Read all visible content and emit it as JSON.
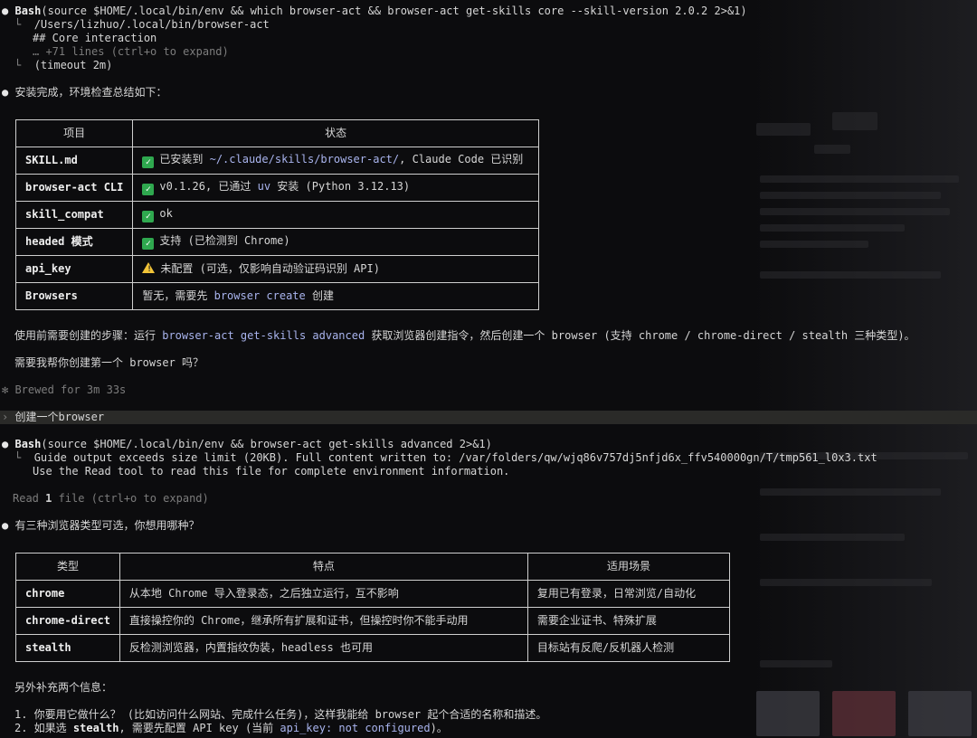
{
  "log": {
    "bash1": {
      "tool": "Bash",
      "command": "(source $HOME/.local/bin/env && which browser-act && browser-act get-skills core --skill-version 2.0.2 2>&1)"
    },
    "bash1_out": [
      "/Users/lizhuo/.local/bin/browser-act",
      "## Core interaction"
    ],
    "bash1_more": "… +71 lines (ctrl+o to expand)",
    "bash1_timeout": "(timeout 2m)",
    "summary_intro": "安装完成，环境检查总结如下：",
    "table1": {
      "headers": [
        "项目",
        "状态"
      ],
      "rows": [
        {
          "key": "SKILL.md",
          "icon": "check",
          "pre": "已安装到 ",
          "code": "~/.claude/skills/browser-act/",
          "post": ", Claude Code 已识别"
        },
        {
          "key": "browser-act CLI",
          "icon": "check",
          "pre": "v0.1.26, 已通过 ",
          "code": "uv",
          "post": " 安装 (Python 3.12.13)"
        },
        {
          "key": "skill_compat",
          "icon": "check",
          "pre": "ok",
          "code": "",
          "post": ""
        },
        {
          "key": "headed 模式",
          "icon": "check",
          "pre": "支持 (已检测到 Chrome)",
          "code": "",
          "post": ""
        },
        {
          "key": "api_key",
          "icon": "warning",
          "pre": "未配置 (可选，仅影响自动验证码识别 API)",
          "code": "",
          "post": ""
        },
        {
          "key": "Browsers",
          "icon": "",
          "pre": "暂无，需要先 ",
          "code": "browser create",
          "post": " 创建"
        }
      ]
    },
    "steps": {
      "pre": "使用前需要创建的步骤：运行 ",
      "code": "browser-act get-skills advanced",
      "post": " 获取浏览器创建指令，然后创建一个 browser (支持 chrome / chrome-direct / stealth 三种类型)。"
    },
    "question1": "需要我帮你创建第一个 browser 吗？",
    "brewed": "✻ Brewed for 3m 33s",
    "user_prompt": {
      "marker": "›",
      "text": "创建一个browser"
    },
    "bash2": {
      "tool": "Bash",
      "command": "(source $HOME/.local/bin/env && browser-act get-skills advanced 2>&1)"
    },
    "bash2_out": [
      "Guide output exceeds size limit (20KB). Full content written to: /var/folders/qw/wjq86v757dj5nfjd6x_ffv540000gn/T/tmp561_l0x3.txt",
      "Use the Read tool to read this file for complete environment information."
    ],
    "read_line": {
      "pre": "Read ",
      "count": "1",
      "post": " file (ctrl+o to expand)"
    },
    "types_intro": "有三种浏览器类型可选，你想用哪种？",
    "table2": {
      "headers": [
        "类型",
        "特点",
        "适用场景"
      ],
      "rows": [
        [
          "chrome",
          "从本地 Chrome 导入登录态，之后独立运行，互不影响",
          "复用已有登录，日常浏览/自动化"
        ],
        [
          "chrome-direct",
          "直接操控你的 Chrome，继承所有扩展和证书，但操控时你不能手动用",
          "需要企业证书、特殊扩展"
        ],
        [
          "stealth",
          "反检测浏览器，内置指纹伪装，headless 也可用",
          "目标站有反爬/反机器人检测"
        ]
      ]
    },
    "extra_intro": "另外补充两个信息：",
    "item1": "1. 你要用它做什么？ (比如访问什么网站、完成什么任务)，这样我能给 browser 起个合适的名称和描述。",
    "item2": {
      "pre": "2. 如果选 ",
      "bold": "stealth",
      "mid": ", 需要先配置 API key (当前 ",
      "code": "api_key: not configured",
      "post": ")。"
    },
    "colors": {
      "background": "#0c0c0e",
      "text": "#d6d6d6",
      "code": "#a9b4ee",
      "dim": "#7c7c7c",
      "prompt_bar": "#2a2a28",
      "check": "#2fa84f",
      "warning": "#f2c438"
    }
  }
}
